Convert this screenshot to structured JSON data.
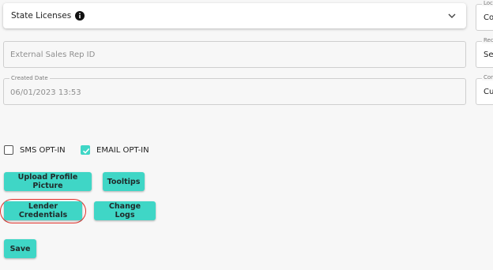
{
  "state_licenses": {
    "title": "State Licenses",
    "info_icon": "info-icon",
    "expand_icon": "chevron-down-icon"
  },
  "external_sales_rep": {
    "placeholder": "External Sales Rep ID"
  },
  "created_date": {
    "label": "Created Date",
    "value": "06/01/2023 13:53"
  },
  "right_fields": [
    {
      "label": "Loca",
      "value": "Cor"
    },
    {
      "label": "Reco",
      "value": "Sel"
    },
    {
      "label": "Con",
      "value": "Cu"
    }
  ],
  "opt_in": {
    "sms_label": "SMS OPT-IN",
    "sms_checked": false,
    "email_label": "EMAIL OPT-IN",
    "email_checked": true
  },
  "buttons": {
    "upload_profile_picture": "Upload Profile Picture",
    "tooltips": "Tooltips",
    "lender_credentials": "Lender Credentials",
    "change_logs": "Change Logs",
    "save": "Save"
  },
  "colors": {
    "accent": "#3fd6c6",
    "highlight": "#e0302a"
  }
}
